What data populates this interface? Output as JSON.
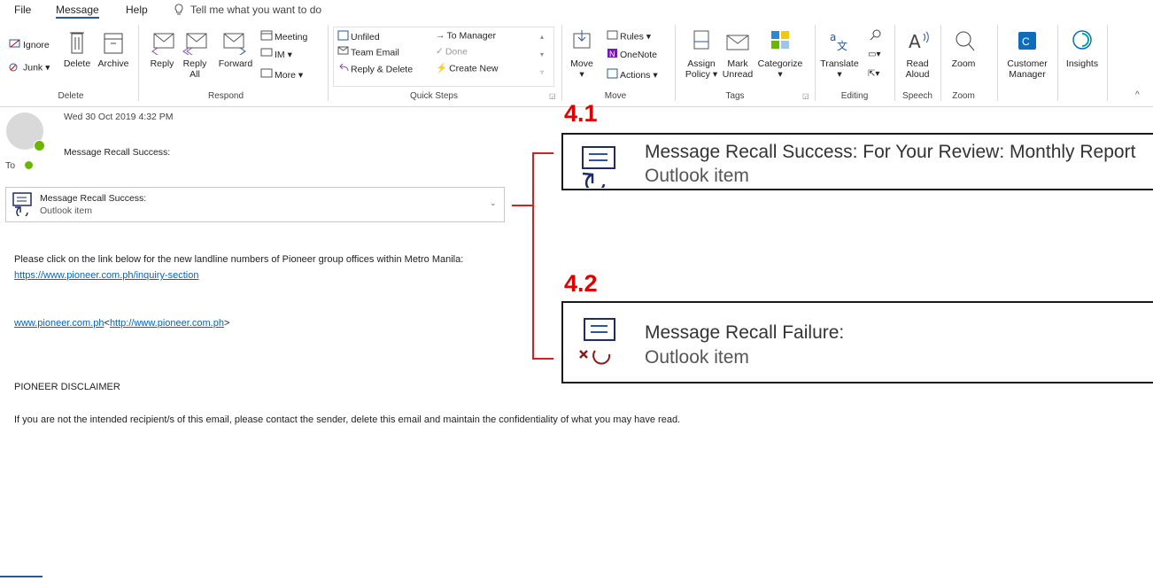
{
  "menu": {
    "file": "File",
    "message": "Message",
    "help": "Help",
    "tell_me": "Tell me what you want to do"
  },
  "ribbon": {
    "delete_group": {
      "ignore": "Ignore",
      "junk": "Junk",
      "delete": "Delete",
      "archive": "Archive",
      "label": "Delete"
    },
    "respond_group": {
      "reply": "Reply",
      "reply_all_1": "Reply",
      "reply_all_2": "All",
      "forward": "Forward",
      "meeting": "Meeting",
      "im": "IM",
      "more": "More",
      "label": "Respond"
    },
    "quick_steps": {
      "unfiled": "Unfiled",
      "team_email": "Team Email",
      "reply_delete": "Reply & Delete",
      "to_manager": "To Manager",
      "done": "Done",
      "create_new": "Create New",
      "label": "Quick Steps"
    },
    "move_group": {
      "move": "Move",
      "rules": "Rules",
      "onenote": "OneNote",
      "actions": "Actions",
      "label": "Move"
    },
    "tags_group": {
      "assign_1": "Assign",
      "assign_2": "Policy",
      "mark_1": "Mark",
      "mark_2": "Unread",
      "categorize": "Categorize",
      "label": "Tags"
    },
    "editing_group": {
      "translate": "Translate",
      "label": "Editing"
    },
    "speech_group": {
      "read_1": "Read",
      "read_2": "Aloud",
      "label": "Speech"
    },
    "zoom_group": {
      "zoom": "Zoom",
      "label": "Zoom"
    },
    "customer_1": "Customer",
    "customer_2": "Manager",
    "insights": "Insights"
  },
  "email": {
    "date": "Wed 30 Oct 2019 4:32 PM",
    "subject": "Message Recall Success:",
    "to_label": "To"
  },
  "attachment": {
    "title": "Message Recall Success:",
    "subtitle": "Outlook item"
  },
  "body": {
    "line1": "Please click on the link below for the new landline numbers of Pioneer group offices within Metro Manila:",
    "link1": "https://www.pioneer.com.ph/inquiry-section",
    "link2a": "www.pioneer.com.ph",
    "link2b": "<",
    "link2c": "http://www.pioneer.com.ph",
    "link2d": ">",
    "disclaimer_title": "PIONEER DISCLAIMER",
    "disclaimer_text": "If you are not the intended recipient/s of this email, please contact the sender, delete this email and maintain the confidentiality of what you may have read."
  },
  "callouts": [
    {
      "number": "4.1",
      "title": "Message Recall Success:  For Your Review: Monthly Report",
      "subtitle": "Outlook item"
    },
    {
      "number": "4.2",
      "title": "Message Recall Failure:",
      "subtitle": "Outlook item"
    }
  ],
  "colors": {
    "accent": "#2b579a",
    "callout_red": "#e10000",
    "link": "#0563c1",
    "presence_green": "#6bb700"
  }
}
